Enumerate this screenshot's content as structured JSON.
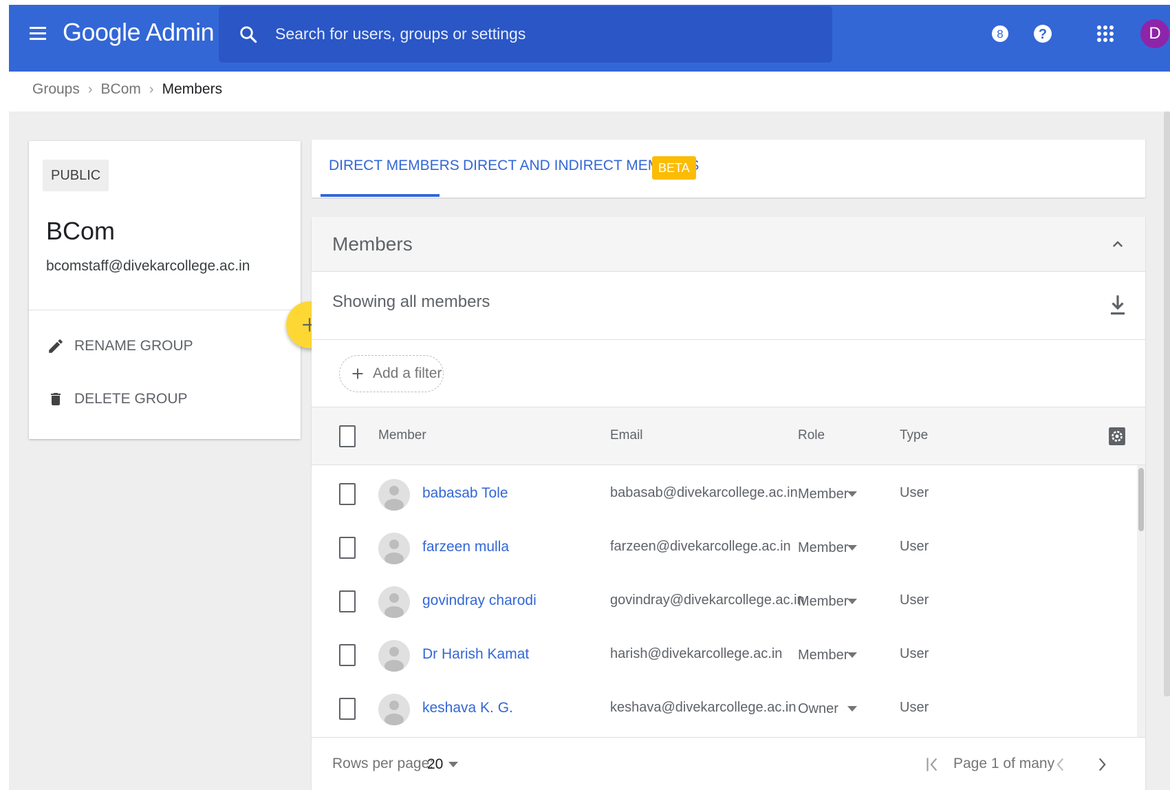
{
  "app": {
    "logo": "Google Admin",
    "search": {
      "placeholder": "Search for users, groups or settings",
      "value": ""
    },
    "badge_count": "8",
    "avatar_initial": "D"
  },
  "breadcrumb": [
    "Groups",
    "BCom",
    "Members"
  ],
  "group": {
    "visibility": "PUBLIC",
    "name": "BCom",
    "email": "bcomstaff@divekarcollege.ac.in",
    "actions": {
      "rename": "RENAME GROUP",
      "delete": "DELETE GROUP"
    }
  },
  "tabs": {
    "direct": "DIRECT MEMBERS",
    "indirect": "DIRECT AND INDIRECT MEMBERS",
    "beta": "BETA"
  },
  "members": {
    "title": "Members",
    "showing": "Showing all members",
    "add_filter": "Add a filter",
    "columns": {
      "member": "Member",
      "email": "Email",
      "role": "Role",
      "type": "Type"
    },
    "rows": [
      {
        "name": "babasab Tole",
        "email": "babasab@divekarcollege.ac.in",
        "role": "Member",
        "type": "User"
      },
      {
        "name": "farzeen mulla",
        "email": "farzeen@divekarcollege.ac.in",
        "role": "Member",
        "type": "User"
      },
      {
        "name": "govindray charodi",
        "email": "govindray@divekarcollege.ac.in",
        "role": "Member",
        "type": "User"
      },
      {
        "name": "Dr Harish Kamat",
        "email": "harish@divekarcollege.ac.in",
        "role": "Member",
        "type": "User"
      },
      {
        "name": "keshava K. G.",
        "email": "keshava@divekarcollege.ac.in",
        "role": "Owner",
        "type": "User"
      }
    ],
    "footer": {
      "rows_per_page_label": "Rows per page:",
      "rows_per_page": "20",
      "page_text": "Page 1 of many"
    }
  },
  "colors": {
    "topbar": "#3367d6",
    "search_bg": "#2a56c6",
    "accent": "#3367d6",
    "fab": "#fdd835",
    "beta": "#fbbc04",
    "avatar": "#8e24aa"
  }
}
